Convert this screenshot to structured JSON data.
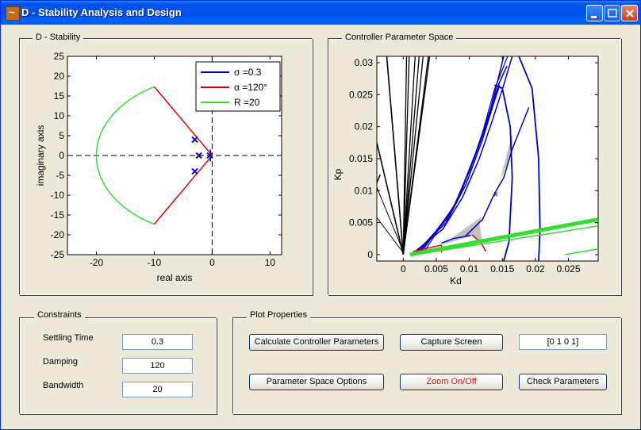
{
  "window": {
    "title": "D - Stability Analysis and Design"
  },
  "panels": {
    "d_stability": {
      "title": "D - Stability"
    },
    "controller_space": {
      "title": "Controller Parameter Space"
    },
    "constraints": {
      "title": "Constraints"
    },
    "plot_properties": {
      "title": "Plot Properties"
    }
  },
  "constraints": {
    "settling_time": {
      "label": "Settling Time",
      "value": "0.3"
    },
    "damping": {
      "label": "Damping",
      "value": "120"
    },
    "bandwidth": {
      "label": "Bandwidth",
      "value": "20"
    }
  },
  "plot_properties": {
    "calculate_label": "Calculate Controller Parameters",
    "capture_label": "Capture Screen",
    "vector_value": "[0 1 0 1]",
    "param_options_label": "Parameter Space Options",
    "zoom_label": "Zoom On/Off",
    "check_label": "Check Parameters",
    "zoom_color": "#ff0000"
  },
  "chart_data": [
    {
      "type": "line",
      "xlabel": "real axis",
      "ylabel": "imaginary axis",
      "xlim": [
        -25,
        12
      ],
      "ylim": [
        -25,
        25
      ],
      "xticks": [
        "-20",
        "-10",
        "0",
        "10"
      ],
      "yticks": [
        "25",
        "20",
        "15",
        "10",
        "5",
        "0",
        "-5",
        "-10",
        "-15",
        "-20",
        "-25"
      ],
      "legend_position": "top-right",
      "series": [
        {
          "name": "σ =0.3",
          "color": "#0000cc",
          "kind": "vertical-boundary",
          "x": -0.3,
          "y_range": [
            -1.5,
            1.5
          ]
        },
        {
          "name": "α =120°",
          "color": "#dd0000",
          "kind": "sector",
          "vertex": [
            0,
            0
          ],
          "x_end": -10,
          "y_end": 17.32
        },
        {
          "name": "R =20",
          "color": "#33dd33",
          "kind": "arc",
          "radius": 20,
          "theta_range_deg": [
            120,
            240
          ]
        }
      ],
      "poles": [
        [
          -3,
          4
        ],
        [
          -3,
          -4
        ],
        [
          -2.3,
          0
        ],
        [
          -0.4,
          0
        ]
      ],
      "pole_color": "#1010cc"
    },
    {
      "type": "line",
      "xlabel": "Kd",
      "ylabel": "Kp",
      "xlim": [
        -0.004,
        0.0295
      ],
      "ylim": [
        -0.001,
        0.031
      ],
      "xticks": [
        "0",
        "0.005",
        "0.01",
        "0.015",
        "0.02",
        "0.025"
      ],
      "yticks": [
        "0.03",
        "0.025",
        "0.02",
        "0.015",
        "0.01",
        "0.005",
        "0"
      ],
      "marker_label": "x",
      "marker": [
        0.014,
        0.0095
      ],
      "stable_region_color": "#c0c0c0"
    }
  ]
}
